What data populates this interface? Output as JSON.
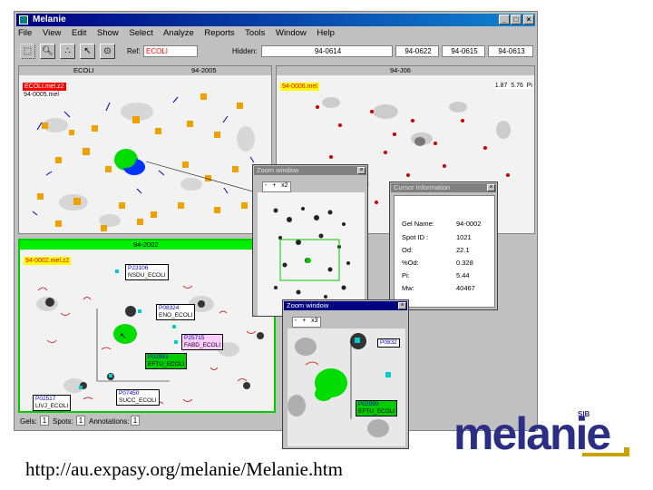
{
  "window": {
    "title": "Melanie",
    "controls": {
      "minimize": "_",
      "maximize": "□",
      "close": "×"
    }
  },
  "menu": [
    "File",
    "View",
    "Edit",
    "Show",
    "Select",
    "Analyze",
    "Reports",
    "Tools",
    "Window",
    "Help"
  ],
  "toolbar": {
    "ref_label": "Ref:",
    "ref_value": "ECOLI",
    "hidden_label": "Hidden:",
    "gels": [
      "94-0614",
      "94-0622",
      "94-0615",
      "94-0613"
    ]
  },
  "panels": {
    "top_left": {
      "tab_left": "ECOLI",
      "tab_right": "94-2005",
      "label1": "ECOLI.mel.z2",
      "label2": "94-0005.mel"
    },
    "top_right": {
      "tab": "94-J06",
      "label": "94-0006.mel",
      "readout_a": "1.87",
      "readout_b": "5.76",
      "readout_c": "Pi"
    },
    "bottom_left": {
      "tab": "94-2002",
      "label": "94-0002.mel.z2",
      "annotations": [
        {
          "id": "P23106",
          "name": "NSDU_ECOLI",
          "style": "white"
        },
        {
          "id": "P08324",
          "name": "ENO_ECOLI",
          "style": "white"
        },
        {
          "id": "P25715",
          "name": "FABD_ECOLI",
          "style": "pink"
        },
        {
          "id": "P02993",
          "name": "EFTU_ECOLI",
          "style": "green"
        },
        {
          "id": "P02517",
          "name": "LIVJ_ECOLI",
          "style": "white"
        },
        {
          "id": "P07450",
          "name": "SUCC_ECOLI",
          "style": "white"
        }
      ]
    }
  },
  "zoom1": {
    "title": "Zoom window",
    "controls": [
      "-",
      "+",
      "x2"
    ]
  },
  "zoom2": {
    "title": "Zoom window",
    "controls": [
      "-",
      "+",
      "x3"
    ],
    "annotations": [
      {
        "id": "P0832",
        "name": ""
      },
      {
        "id": "P02990",
        "name": "EFTU_ECOLI"
      }
    ]
  },
  "cursor_info": {
    "title": "Cursor Information",
    "rows": [
      {
        "label": "Gel Name:",
        "value": "94-0002"
      },
      {
        "label": "Spot ID :",
        "value": "1021"
      },
      {
        "label": "Od:",
        "value": "22.1"
      },
      {
        "label": "%Od:",
        "value": "0.328"
      },
      {
        "label": "Pi:",
        "value": "5.44"
      },
      {
        "label": "Mw:",
        "value": "40467"
      }
    ]
  },
  "status": {
    "gels_label": "Gels:",
    "gels_value": "1",
    "spots_label": "Spots:",
    "spots_value": "1",
    "ann_label": "Annotations:",
    "ann_value": "1"
  },
  "caption": "http://au.expasy.org/melanie/Melanie.htm",
  "logo": {
    "text": "melanie",
    "badge": "SIB",
    "color": "#2a2f85",
    "accent": "#c8a400"
  }
}
